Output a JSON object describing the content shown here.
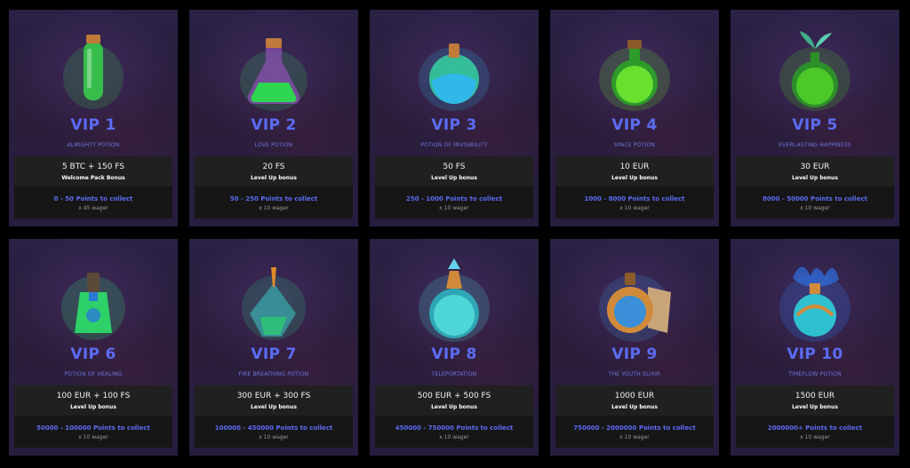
{
  "vip_levels": [
    {
      "title": "VIP 1",
      "potion": "ALMIGHTY POTION",
      "reward": "5 BTC + 150 FS",
      "reward_type": "Welcome Pack Bonus",
      "points": "0 - 50 Points to collect",
      "wager": "x 45 wager",
      "icon": "almighty-potion-icon",
      "liquid": "#37d24a",
      "glass": "#7fe08a"
    },
    {
      "title": "VIP 2",
      "potion": "LOVE POTION",
      "reward": "20 FS",
      "reward_type": "Level Up bonus",
      "points": "50 - 250 Points to collect",
      "wager": "x 10 wager",
      "icon": "love-potion-icon",
      "liquid": "#2fd651",
      "glass": "#8a4fb0"
    },
    {
      "title": "VIP 3",
      "potion": "POTION OF INVISIBILITY",
      "reward": "50 FS",
      "reward_type": "Level Up bonus",
      "points": "250 - 1000 Points to collect",
      "wager": "x 10 wager",
      "icon": "invisibility-potion-icon",
      "liquid": "#2fb8e8",
      "glass": "#34d3a0"
    },
    {
      "title": "VIP 4",
      "potion": "SPACE POTION",
      "reward": "10 EUR",
      "reward_type": "Level Up bonus",
      "points": "1000 - 8000 Points to collect",
      "wager": "x 10 wager",
      "icon": "space-potion-icon",
      "liquid": "#67e02f",
      "glass": "#2d9a2a"
    },
    {
      "title": "VIP 5",
      "potion": "EVERLASTING HAPPINESS",
      "reward": "30 EUR",
      "reward_type": "Level Up bonus",
      "points": "8000 - 50000 Points to collect",
      "wager": "x 10 wager",
      "icon": "everlasting-happiness-potion-icon",
      "liquid": "#4cc828",
      "glass": "#2c8f2a"
    },
    {
      "title": "VIP 6",
      "potion": "POTION OF HEALING",
      "reward": "100 EUR + 100 FS",
      "reward_type": "Level Up bonus",
      "points": "50000 - 100000 Points to collect",
      "wager": "x 10 wager",
      "icon": "healing-potion-icon",
      "liquid": "#2ee06a",
      "glass": "#2a7bd6"
    },
    {
      "title": "VIP 7",
      "potion": "FIRE BREATHING POTION",
      "reward": "300 EUR + 300 FS",
      "reward_type": "Level Up bonus",
      "points": "100000 - 450000 Points to collect",
      "wager": "x 10 wager",
      "icon": "fire-breathing-potion-icon",
      "liquid": "#2fbf7a",
      "glass": "#3a9aa0"
    },
    {
      "title": "VIP 8",
      "potion": "TELEPORTATION",
      "reward": "500 EUR + 500 FS",
      "reward_type": "Level Up bonus",
      "points": "450000 - 750000 Points to collect",
      "wager": "x 10 wager",
      "icon": "teleportation-potion-icon",
      "liquid": "#4fd6d6",
      "glass": "#2fa6b5"
    },
    {
      "title": "VIP 9",
      "potion": "THE YOUTH ELIXIR",
      "reward": "1000 EUR",
      "reward_type": "Level Up bonus",
      "points": "750000 - 2000000 Points to collect",
      "wager": "x 10 wager",
      "icon": "youth-elixir-icon",
      "liquid": "#3a8fd8",
      "glass": "#d18a3a"
    },
    {
      "title": "VIP 10",
      "potion": "TIMEFLOW POTION",
      "reward": "1500 EUR",
      "reward_type": "Level Up bonus",
      "points": "2000000+ Points to collect",
      "wager": "x 10 wager",
      "icon": "timeflow-potion-icon",
      "liquid": "#2fc0d0",
      "glass": "#2f6fe0"
    }
  ],
  "colors": {
    "accent": "#5b6cf4",
    "card_bg": "#2a2145",
    "info_bg": "#161616",
    "info_top_bg": "#202020"
  }
}
